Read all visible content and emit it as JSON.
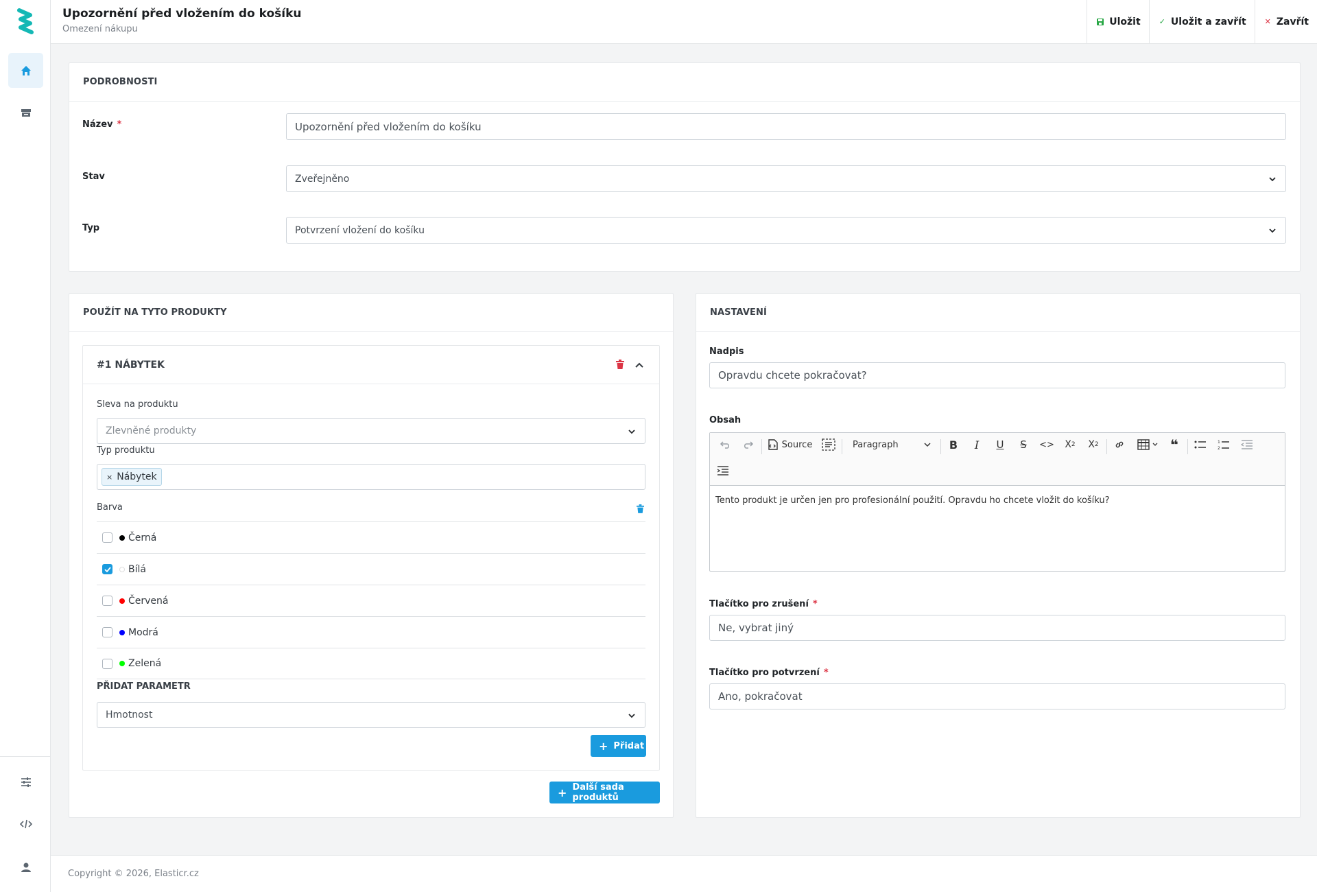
{
  "header": {
    "title": "Upozornění před vložením do košíku",
    "subtitle": "Omezení nákupu",
    "actions": {
      "save": "Uložit",
      "save_close": "Uložit a zavřít",
      "close": "Zavřít"
    }
  },
  "details": {
    "heading": "PODROBNOSTI",
    "name_label": "Název",
    "name_value": "Upozornění před vložením do košíku",
    "status_label": "Stav",
    "status_value": "Zveřejněno",
    "type_label": "Typ",
    "type_value": "Potvrzení vložení do košíku"
  },
  "products": {
    "heading": "POUŽÍT NA TYTO PRODUKTY",
    "set_title": "#1 NÁBYTEK",
    "discount_label": "Sleva na produktu",
    "discount_placeholder": "Zlevněné produkty",
    "product_type_label": "Typ produktu",
    "product_type_tag": "Nábytek",
    "color_label": "Barva",
    "colors": [
      {
        "label": "Černá",
        "checked": false,
        "color": "#000000"
      },
      {
        "label": "Bílá",
        "checked": true,
        "color": "#ffffff"
      },
      {
        "label": "Červená",
        "checked": false,
        "color": "#ff0000"
      },
      {
        "label": "Modrá",
        "checked": false,
        "color": "#0000ff"
      },
      {
        "label": "Zelená",
        "checked": false,
        "color": "#00ff00"
      }
    ],
    "add_param_label": "PŘIDAT PARAMETR",
    "add_param_value": "Hmotnost",
    "add_button": "Přidat",
    "next_set_button": "Další sada produktů"
  },
  "settings": {
    "heading": "NASTAVENÍ",
    "title_label": "Nadpis",
    "title_value": "Opravdu chcete pokračovat?",
    "content_label": "Obsah",
    "editor": {
      "source": "Source",
      "paragraph": "Paragraph",
      "content": "Tento produkt je určen jen pro profesionální použití. Opravdu ho chcete vložit do košíku?"
    },
    "cancel_label": "Tlačítko pro zrušení",
    "cancel_value": "Ne, vybrat jiný",
    "confirm_label": "Tlačítko pro potvrzení",
    "confirm_value": "Ano, pokračovat"
  },
  "footer": {
    "text": "Copyright © 2026, Elasticr.cz"
  },
  "colors": {
    "accent": "#1a9bde",
    "logo": "#14b8b5",
    "required": "#dc3545",
    "delete": "#dc3545"
  }
}
